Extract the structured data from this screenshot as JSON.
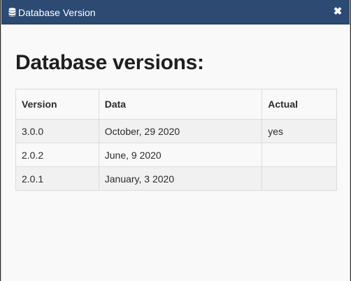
{
  "window": {
    "title": "Database Version",
    "close_label": "✖"
  },
  "main": {
    "heading": "Database versions:"
  },
  "table": {
    "columns": [
      "Version",
      "Data",
      "Actual"
    ],
    "rows": [
      [
        "3.0.0",
        "October, 29 2020",
        "yes"
      ],
      [
        "2.0.2",
        "June, 9 2020",
        ""
      ],
      [
        "2.0.1",
        "January, 3 2020",
        ""
      ]
    ]
  },
  "colors": {
    "titlebar": "#2c4a72",
    "background": "#f9f9f9",
    "row_stripe": "#f1f1f1"
  },
  "icons": {
    "title_icon": "database-icon",
    "close_icon": "close-icon"
  }
}
